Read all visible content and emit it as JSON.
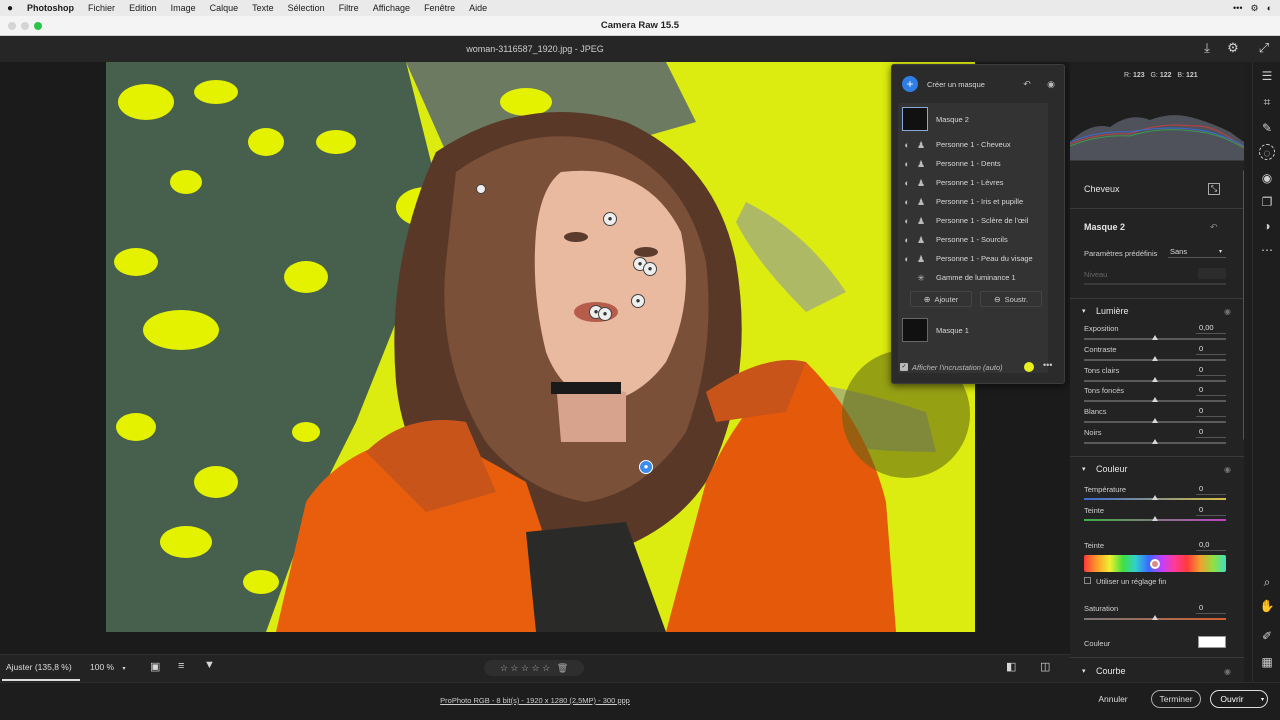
{
  "menubar": {
    "apple": "",
    "app": "Photoshop",
    "items": [
      "Fichier",
      "Edition",
      "Image",
      "Calque",
      "Texte",
      "Sélection",
      "Filtre",
      "Affichage",
      "Fenêtre",
      "Aide"
    ]
  },
  "window": {
    "title": "Camera Raw 15.5"
  },
  "document": {
    "name": "woman-3116587_1920.jpg  -  JPEG"
  },
  "mask_panel": {
    "create_label": "Créer un masque",
    "masks": [
      {
        "name": "Masque 2"
      },
      {
        "name": "Masque 1"
      }
    ],
    "components": [
      "Personne 1 - Cheveux",
      "Personne 1 - Dents",
      "Personne 1 - Lèvres",
      "Personne 1 - Iris et pupille",
      "Personne 1 - Sclère de l'œil",
      "Personne 1 - Sourcils",
      "Personne 1 - Peau du visage",
      "Gamme de luminance 1"
    ],
    "add_label": "Ajouter",
    "subtract_label": "Soustr.",
    "overlay_label": "Afficher l'incrustation (auto)",
    "overlay_checked": true,
    "overlay_color": "#e6f020"
  },
  "histogram": {
    "r_label": "R:",
    "r": "123",
    "g_label": "G:",
    "g": "122",
    "b_label": "B:",
    "b": "121"
  },
  "right_panel": {
    "component_title": "Cheveux",
    "mask_title": "Masque 2",
    "preset_label": "Paramètres prédéfinis",
    "preset_value": "Sans",
    "level_label": "Niveau",
    "light": {
      "title": "Lumière",
      "sliders": [
        {
          "label": "Exposition",
          "value": "0,00",
          "pos": 0.5
        },
        {
          "label": "Contraste",
          "value": "0",
          "pos": 0.5
        },
        {
          "label": "Tons clairs",
          "value": "0",
          "pos": 0.5
        },
        {
          "label": "Tons foncés",
          "value": "0",
          "pos": 0.5
        },
        {
          "label": "Blancs",
          "value": "0",
          "pos": 0.5
        },
        {
          "label": "Noirs",
          "value": "0",
          "pos": 0.5
        }
      ]
    },
    "color": {
      "title": "Couleur",
      "temperature_label": "Température",
      "temperature_value": "0",
      "tint_label": "Teinte",
      "tint_value": "0",
      "hue_label": "Teinte",
      "hue_value": "0,0",
      "fine_label": "Utiliser un réglage fin",
      "saturation_label": "Saturation",
      "saturation_value": "0",
      "color_label": "Couleur"
    },
    "curve": {
      "title": "Courbe"
    }
  },
  "bottom_bar": {
    "fit_label": "Ajuster (135,8 %)",
    "zoom_label": "100 %",
    "stars": "☆ ☆ ☆ ☆ ☆"
  },
  "status": {
    "info": "ProPhoto RGB - 8 bit(s) - 1920 x 1280 (2,5MP) - 300 ppp",
    "cancel": "Annuler",
    "done": "Terminer",
    "open": "Ouvrir"
  }
}
